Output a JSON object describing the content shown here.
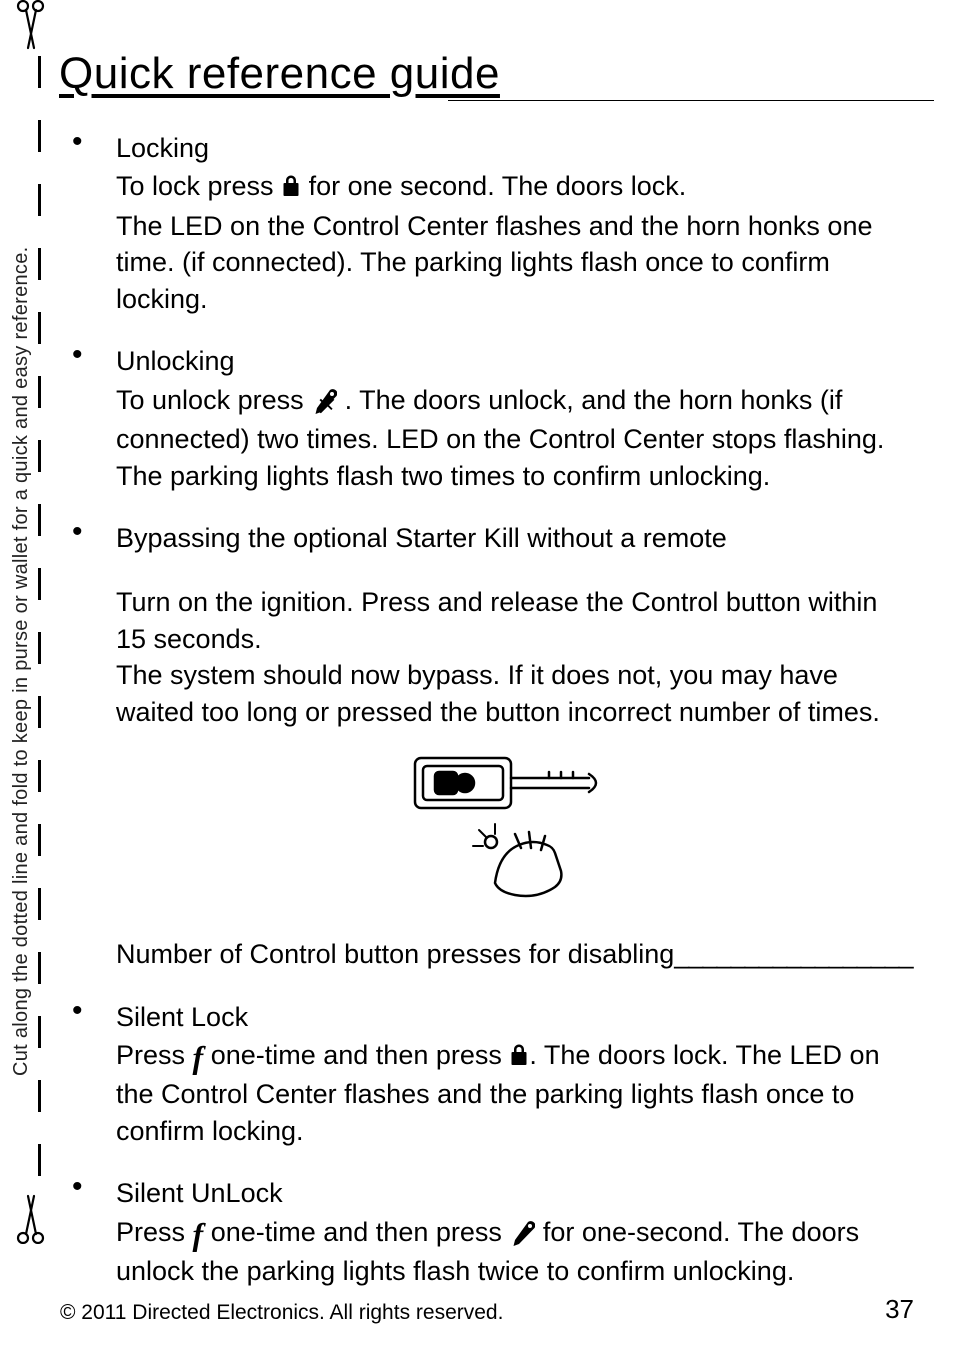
{
  "title": "Quick reference guide",
  "side_text": "Cut along the dotted line and fold to keep in purse or wallet for a quick and easy reference.",
  "items": {
    "locking": {
      "title": "Locking",
      "line1a": "To lock press ",
      "line1b": " for one second. The doors lock.",
      "line2": "The LED on the Control Center flashes and the horn honks one time. (if connected). The parking lights flash once to confirm locking."
    },
    "unlocking": {
      "title": "Unlocking",
      "line1a": "To unlock press ",
      "line1b": " . The doors unlock, and the horn honks (if connected) two times.  LED on the Control Center stops flashing. The parking lights flash two times to confirm unlocking."
    },
    "bypass": {
      "title": "Bypassing the optional Starter Kill without a remote",
      "p1": "Turn on the ignition. Press and release the Control button within 15 seconds.",
      "p2": "The system should now bypass. If it does not, you may have waited too long or pressed the button incorrect number of times.",
      "caption_a": "Number of Control button presses for disabling",
      "caption_blank": "_________________"
    },
    "silent_lock": {
      "title": "Silent Lock",
      "a": "Press ",
      "b": " one-time and then press ",
      "c": ". The doors lock. The LED  on the Control Center flashes and the parking lights flash once to confirm locking."
    },
    "silent_unlock": {
      "title": "Silent UnLock",
      "a": "Press ",
      "b": " one-time and then press ",
      "c": " for one-second. The doors unlock the parking lights flash twice to confirm unlocking."
    }
  },
  "icons": {
    "f_glyph": "f"
  },
  "footer": {
    "copyright": "© 2011 Directed Electronics. All rights reserved.",
    "page": "37"
  }
}
